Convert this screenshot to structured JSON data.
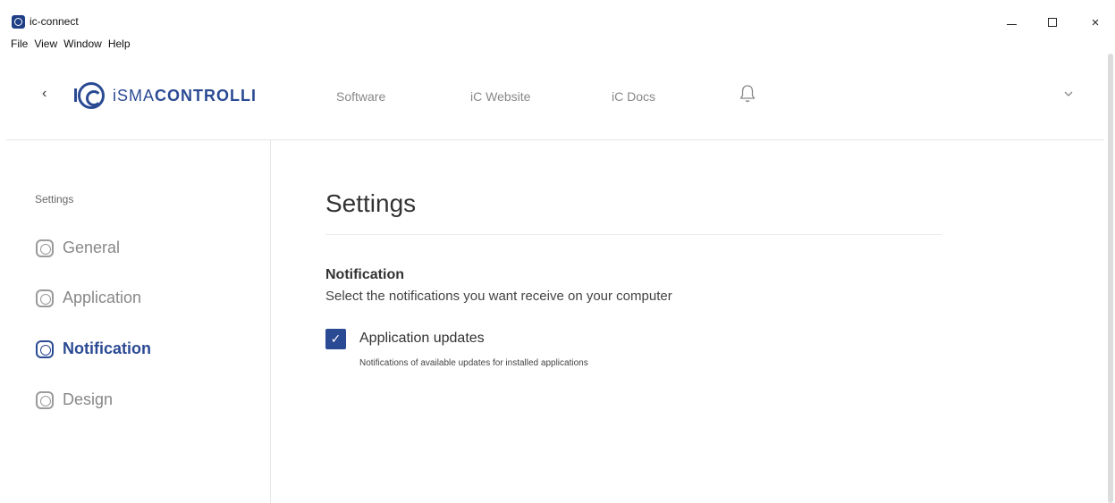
{
  "window": {
    "title": "ic-connect",
    "icon": "ic-connect-app-icon",
    "controls": {
      "minimize": "minimize-icon",
      "maximize": "maximize-icon",
      "close": "×"
    }
  },
  "menubar": {
    "items": [
      "File",
      "View",
      "Window",
      "Help"
    ]
  },
  "header": {
    "back": "‹",
    "logo_prefix": "iSMA",
    "logo_bold": "CONTROLLI",
    "nav": [
      "Software",
      "iC Website",
      "iC Docs"
    ],
    "bell_icon": "bell-icon",
    "chevron_icon": "chevron-down-icon"
  },
  "sidebar": {
    "heading": "Settings",
    "items": [
      {
        "label": "General",
        "active": false
      },
      {
        "label": "Application",
        "active": false
      },
      {
        "label": "Notification",
        "active": true
      },
      {
        "label": "Design",
        "active": false
      }
    ]
  },
  "main": {
    "title": "Settings",
    "section_title": "Notification",
    "section_desc": "Select the notifications you want receive on your computer",
    "options": [
      {
        "label": "Application updates",
        "description": "Notifications of available updates for installed applications",
        "checked": true,
        "check_glyph": "✓"
      }
    ]
  },
  "colors": {
    "accent": "#2b4a94",
    "muted_text": "#888888",
    "divider": "#e6e6e6"
  }
}
